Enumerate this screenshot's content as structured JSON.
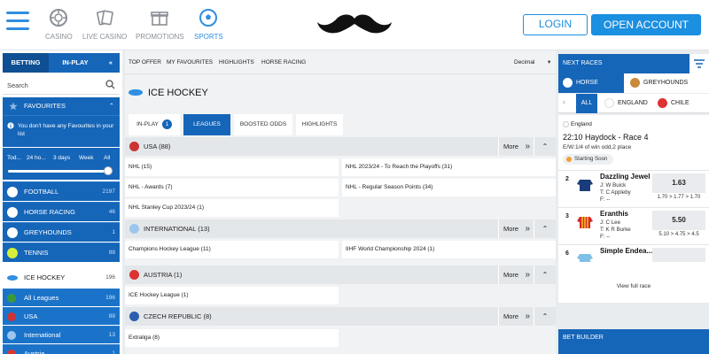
{
  "header": {
    "nav": [
      {
        "label": "CASINO",
        "icon": "casino-chip-icon"
      },
      {
        "label": "LIVE CASINO",
        "icon": "cards-icon"
      },
      {
        "label": "PROMOTIONS",
        "icon": "gift-icon"
      },
      {
        "label": "SPORTS",
        "icon": "soccer-ball-icon",
        "active": true
      }
    ],
    "logo": "mustache-logo",
    "login": "LOGIN",
    "open_account": "OPEN ACCOUNT"
  },
  "sidebar": {
    "tabs": [
      "BETTING",
      "IN-PLAY"
    ],
    "collapse_icon": "double-chevron-left-icon",
    "search_label": "Search",
    "favourites_title": "FAVOURITES",
    "favourites_msg": "You don't have any Favourites in your list",
    "time_filters": [
      "Tod...",
      "24 ho...",
      "3 days",
      "Week",
      "All"
    ],
    "sports": [
      {
        "label": "FOOTBALL",
        "count": "2197",
        "icon": "football-icon"
      },
      {
        "label": "HORSE RACING",
        "count": "46",
        "icon": "horse-icon"
      },
      {
        "label": "GREYHOUNDS",
        "count": "1",
        "icon": "greyhound-icon"
      },
      {
        "label": "TENNIS",
        "count": "98",
        "icon": "tennis-ball-icon"
      },
      {
        "label": "ICE HOCKEY",
        "count": "196",
        "icon": "puck-icon"
      }
    ],
    "sub_items": [
      {
        "label": "All Leagues",
        "count": "196"
      },
      {
        "label": "USA",
        "count": "88"
      },
      {
        "label": "International",
        "count": "13"
      },
      {
        "label": "Austria",
        "count": "1"
      }
    ]
  },
  "main": {
    "topbar": [
      "TOP OFFER",
      "MY FAVOURITES",
      "HIGHLIGHTS",
      "HORSE RACING"
    ],
    "odds_format": "Decimal",
    "title": "ICE HOCKEY",
    "tabs": [
      "IN-PLAY",
      "LEAGUES",
      "BOOSTED ODDS",
      "HIGHLIGHTS"
    ],
    "inplay_count": "1",
    "more_label": "More",
    "categories": [
      {
        "label": "USA (88)",
        "cells": [
          "NHL (15)",
          "NHL 2023/24 - To Reach the Playoffs (31)",
          "NHL - Awards (7)",
          "NHL - Regular Season Points (34)",
          "NHL Stanley Cup 2023/24 (1)"
        ]
      },
      {
        "label": "INTERNATIONAL (13)",
        "cells": [
          "Champions Hockey League (11)",
          "IIHF World Championship 2024 (1)"
        ]
      },
      {
        "label": "AUSTRIA (1)",
        "cells": [
          "ICE Hockey League (1)"
        ]
      },
      {
        "label": "CZECH REPUBLIC (8)",
        "cells": [
          "Extraliga (8)"
        ]
      }
    ]
  },
  "right": {
    "next_races": "NEXT RACES",
    "tabs": [
      "HORSE RACING",
      "GREYHOUNDS"
    ],
    "countries": [
      "ALL",
      "ENGLAND",
      "CHILE"
    ],
    "race": {
      "country": "England",
      "title": "22:10 Haydock - Race 4",
      "ew": "E/W:1/4 of win odd,2 place",
      "status": "Starting Soon",
      "runners": [
        {
          "no": "2",
          "name": "Dazzling Jewel",
          "jockey": "J: W Buick",
          "trainer": "T: C Appleby",
          "form": "F: --",
          "odds": "1.63",
          "history": "1.70 > 1.77 > 1.70"
        },
        {
          "no": "3",
          "name": "Eranthis",
          "jockey": "J: C Lee",
          "trainer": "T: K R Burke",
          "form": "F: --",
          "odds": "5.50",
          "history": "5.10 > 4.75 > 4.5"
        },
        {
          "no": "6",
          "name": "Simple Endea...",
          "jockey": "",
          "trainer": "",
          "form": "",
          "odds": "",
          "history": ""
        }
      ],
      "view_full": "View full race"
    },
    "bet_builder": "BET BUILDER"
  },
  "colors": {
    "brand": "#1565b8",
    "accent": "#1b8fe0"
  }
}
